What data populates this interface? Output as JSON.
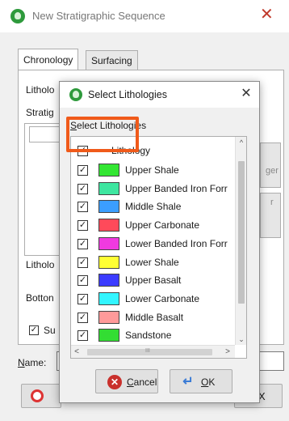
{
  "window": {
    "title": "New Stratigraphic Sequence",
    "tabs": [
      "Chronology",
      "Surfacing"
    ],
    "labels": {
      "lithology_partial": "Litholo",
      "strati_partial": "Stratig",
      "lithology2_partial": "Litholo",
      "bottom_partial": "Botton",
      "su_partial": "Su"
    },
    "side_button_fragments": [
      "ger",
      "r"
    ],
    "name_label_u": "N",
    "name_label_rest": "ame:",
    "name_value": "",
    "close_label": "X"
  },
  "dialog": {
    "title": "Select Lithologies",
    "section_label_u": "S",
    "section_label_rest": "elect Lithologies",
    "header": {
      "label": "Lithology",
      "checked": true
    },
    "items": [
      {
        "label": "Upper Shale",
        "color": "#33e633",
        "checked": true
      },
      {
        "label": "Upper Banded Iron Forr",
        "color": "#3ee6a0",
        "checked": true
      },
      {
        "label": "Middle Shale",
        "color": "#3b9eff",
        "checked": true
      },
      {
        "label": "Upper Carbonate",
        "color": "#ff4a5a",
        "checked": true
      },
      {
        "label": "Lower Banded Iron Forr",
        "color": "#f03ae0",
        "checked": true
      },
      {
        "label": "Lower Shale",
        "color": "#ffff33",
        "checked": true
      },
      {
        "label": "Upper Basalt",
        "color": "#3b3bff",
        "checked": true
      },
      {
        "label": "Lower Carbonate",
        "color": "#33f5ff",
        "checked": true
      },
      {
        "label": "Middle Basalt",
        "color": "#ff9a9a",
        "checked": true
      },
      {
        "label": "Sandstone",
        "color": "#33dd33",
        "checked": true
      }
    ],
    "scroll_grip": "III",
    "buttons": {
      "cancel_u": "C",
      "cancel_rest": "ancel",
      "ok_u": "O",
      "ok_rest": "K"
    }
  },
  "colors": {
    "highlight": "#f05a1a",
    "app_logo": "#2e9a3c"
  }
}
